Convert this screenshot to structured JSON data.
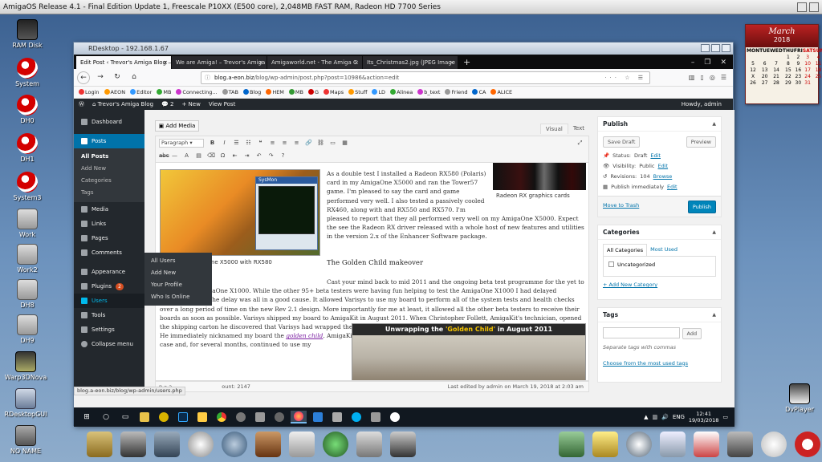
{
  "amiga": {
    "title": "AmigaOS Release 4.1 - Final Edition Update 1, Freescale P10XX (E500 core), 2,048MB FAST RAM, Radeon HD 7700 Series"
  },
  "desktop_icons": [
    {
      "label": "RAM Disk",
      "icon": "ram-disk-icon"
    },
    {
      "label": "System",
      "icon": "boing-ball-icon"
    },
    {
      "label": "DH0",
      "icon": "boing-ball-icon"
    },
    {
      "label": "DH1",
      "icon": "boing-ball-icon"
    },
    {
      "label": "System3",
      "icon": "boing-ball-icon"
    },
    {
      "label": "Work",
      "icon": "drive-icon"
    },
    {
      "label": "Work2",
      "icon": "drive-icon"
    },
    {
      "label": "DH8",
      "icon": "drive-icon"
    },
    {
      "label": "DH9",
      "icon": "drive-icon"
    },
    {
      "label": "Warp3DNova",
      "icon": "warp3d-icon"
    },
    {
      "label": "RDesktopGUI",
      "icon": "rdesktop-icon"
    },
    {
      "label": "NO NAME",
      "icon": "drive-icon"
    }
  ],
  "dvplayer": {
    "label": "DvPlayer"
  },
  "calendar": {
    "month": "March",
    "year": "2018",
    "days_header": [
      "MON",
      "TUE",
      "WED",
      "THU",
      "FRI",
      "SAT",
      "SUN"
    ],
    "cells": [
      "",
      "",
      "",
      "1",
      "2",
      "3",
      "4",
      "5",
      "6",
      "7",
      "8",
      "9",
      "10",
      "11",
      "12",
      "13",
      "14",
      "15",
      "16",
      "17",
      "18",
      "X",
      "20",
      "21",
      "22",
      "23",
      "24",
      "25",
      "26",
      "27",
      "28",
      "29",
      "30",
      "31",
      ""
    ]
  },
  "rdesktop": {
    "title": "RDesktop - 192.168.1.67"
  },
  "browser": {
    "tabs": [
      {
        "label": "Edit Post ‹ Trevor's Amiga Blog — W",
        "active": true
      },
      {
        "label": "We are Amiga! – Trevor's Amiga B",
        "active": false
      },
      {
        "label": "Amigaworld.net - The Amiga C",
        "active": false
      },
      {
        "label": "Its_Christmas2.jpg (JPEG Image",
        "active": false
      }
    ],
    "new_tab": "+",
    "url_host": "blog.a-eon.biz",
    "url_path": "/blog/wp-admin/post.php?post=10986&action=edit",
    "url_right": "··· ☆ ☰",
    "bookmarks": [
      "Login",
      "AEON",
      "Editor",
      "MB",
      "Connecting...",
      "TAB",
      "Blog",
      "HEM",
      "MB",
      "G",
      "Maps",
      "Stuff",
      "LD",
      "Alinea",
      "b_text",
      "Friend",
      "CA",
      "ALICE"
    ]
  },
  "wp": {
    "site": "Trevor's Amiga Blog",
    "comments_count": "2",
    "new_label": "+ New",
    "view_post": "View Post",
    "howdy": "Howdy, admin",
    "menu": [
      {
        "label": "Dashboard"
      },
      {
        "label": "Posts"
      },
      {
        "label": "Media"
      },
      {
        "label": "Links"
      },
      {
        "label": "Pages"
      },
      {
        "label": "Comments"
      },
      {
        "label": "Appearance"
      },
      {
        "label": "Plugins",
        "badge": "2"
      },
      {
        "label": "Users"
      },
      {
        "label": "Tools"
      },
      {
        "label": "Settings"
      },
      {
        "label": "Collapse menu"
      }
    ],
    "posts_sub": [
      "All Posts",
      "Add New",
      "Categories",
      "Tags"
    ],
    "users_flyout": [
      "All Users",
      "Add New",
      "Your Profile",
      "Who Is Online"
    ],
    "add_media": "Add Media",
    "editor_tabs": {
      "visual": "Visual",
      "text": "Text"
    },
    "format_select": "Paragraph",
    "img1_caption": "Tower57 - AmigaOne X5000 with RX580",
    "img1_window": "SysMon",
    "img2_caption": "Radeon RX graphics cards",
    "img3_title_prefix": "Unwrapping the ",
    "img3_title_gold": "'Golden Child'",
    "img3_title_suffix": " in August 2011",
    "para1_a": "As a double test I installed a Radeon RX580 (Polaris) card in my AmigaOne X5000 and ran the Tower57 game. I'm pleased to say the card and game performed very well. I also tested a passively cooled RX460, along with and RX550 and RX570. I'm pleased to report that they all performed very well on my AmigaOne X5000. Expect the see the Radeon RX driver released with a whole host of new features and utilities in the version 2.x of the Enhancer Software package.",
    "heading": "The Golden Child makeover",
    "para2": "Cast your mind back to mid 2011 and the ongoing beta test programme for the yet to be released AmigaOne X1000. While the other 95+ beta testers were having fun helping to test the AmigaOne X1000 I had delayed receiving mine. The delay was all in a good cause. It allowed Varisys to use my board to perform all of the system tests and health checks over a long period of time on the new Rev 2.1 design. More importantly for me at least, it allowed all the other beta testers to receive their boards as soon as possible. Varisys shipped my board to AmigaKit in August 2011. When Christopher Follett, AmigaKit's technician, opened the shipping carton he discovered that Varisys had wrapped the box containing my board in gold wrapping paper to denote its status as the",
    "para2_link": "golden child",
    "para2_b": ". He immediately nicknamed my board the",
    "para2_c": ". AmigaKit build my Nemo board into a nice Boing Ball modified white Fractal tower case and, for several months, continued to use my",
    "path_tag": "p » a",
    "word_count": "ount: 2147",
    "last_edited": "Last edited by admin on March 19, 2018 at 2:03 am",
    "publish": {
      "title": "Publish",
      "save_draft": "Save Draft",
      "preview": "Preview",
      "status_label": "Status:",
      "status_value": "Draft",
      "visibility_label": "Visibility:",
      "visibility_value": "Public",
      "revisions_label": "Revisions:",
      "revisions_value": "104",
      "browse": "Browse",
      "immediately": "Publish immediately",
      "edit": "Edit",
      "trash": "Move to Trash",
      "publish_btn": "Publish"
    },
    "categories": {
      "title": "Categories",
      "tab_all": "All Categories",
      "tab_used": "Most Used",
      "item": "Uncategorized",
      "add_new": "+ Add New Category"
    },
    "tags": {
      "title": "Tags",
      "add": "Add",
      "hint": "Separate tags with commas",
      "choose": "Choose from the most used tags"
    }
  },
  "status_url": "blog.a-eon.biz/blog/wp-admin/users.php",
  "taskbar": {
    "lang": "ENG",
    "time": "12:41",
    "date": "19/03/2018"
  }
}
